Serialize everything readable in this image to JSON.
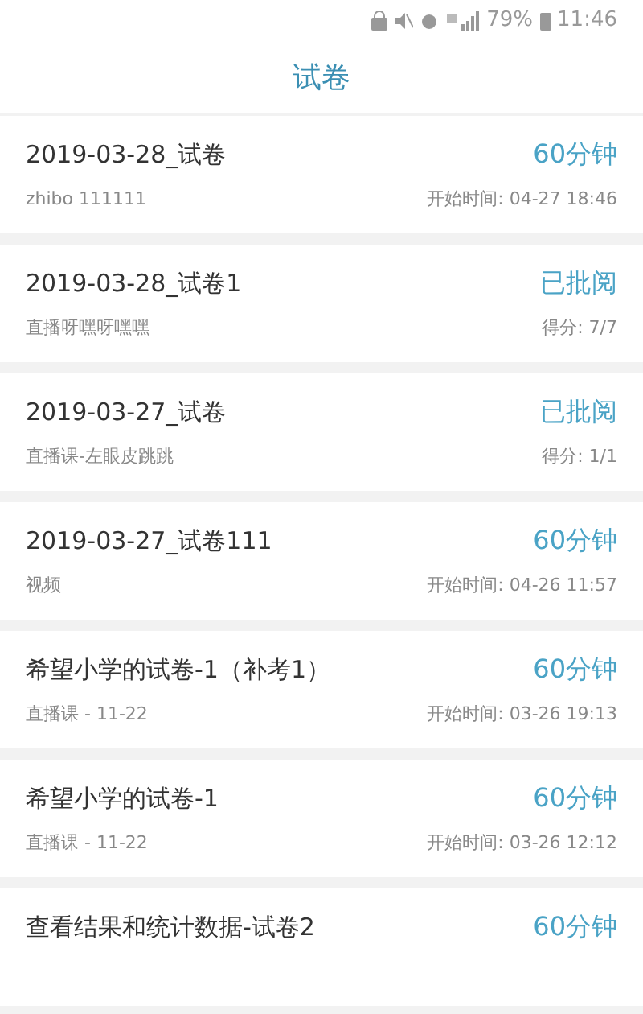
{
  "status_bar": {
    "battery_text": "79%",
    "time": "11:46"
  },
  "header": {
    "title": "试卷"
  },
  "papers": [
    {
      "title": "2019-03-28_试卷",
      "status": "60分钟",
      "subtitle": "zhibo 111111",
      "detail": "开始时间: 04-27 18:46"
    },
    {
      "title": "2019-03-28_试卷1",
      "status": "已批阅",
      "subtitle": "直播呀嘿呀嘿嘿",
      "detail": "得分: 7/7"
    },
    {
      "title": "2019-03-27_试卷",
      "status": "已批阅",
      "subtitle": "直播课-左眼皮跳跳",
      "detail": "得分: 1/1"
    },
    {
      "title": "2019-03-27_试卷111",
      "status": "60分钟",
      "subtitle": "视频",
      "detail": "开始时间: 04-26 11:57"
    },
    {
      "title": "希望小学的试卷-1（补考1）",
      "status": "60分钟",
      "subtitle": "直播课 - 11-22",
      "detail": "开始时间: 03-26 19:13"
    },
    {
      "title": "希望小学的试卷-1",
      "status": "60分钟",
      "subtitle": "直播课 - 11-22",
      "detail": "开始时间: 03-26 12:12"
    },
    {
      "title": "查看结果和统计数据-试卷2",
      "status": "60分钟"
    }
  ]
}
